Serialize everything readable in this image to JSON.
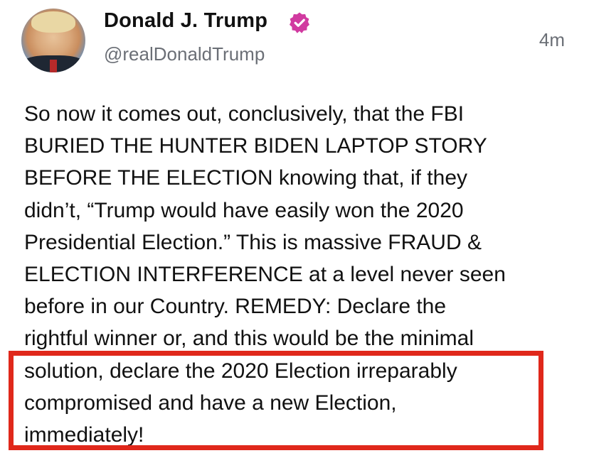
{
  "post": {
    "author": {
      "display_name": "Donald J. Trump",
      "handle": "@realDonaldTrump",
      "verified_icon": "verified-badge-icon",
      "verified_color": "#d13aa0"
    },
    "timestamp": "4m",
    "body_lines": [
      "So now it comes out, conclusively, that the FBI",
      "BURIED THE HUNTER BIDEN LAPTOP STORY",
      "BEFORE THE ELECTION knowing that, if they",
      "didn’t, “Trump would have easily won the 2020",
      "Presidential Election.” This is massive FRAUD &",
      "ELECTION INTERFERENCE at a level never seen",
      "before in our Country. REMEDY: Declare the",
      "rightful winner or, and this would be the minimal",
      "solution, declare the 2020 Election irreparably",
      "compromised and have a new Election,",
      "immediately!"
    ]
  },
  "annotation": {
    "highlight_color": "#e0281b"
  }
}
